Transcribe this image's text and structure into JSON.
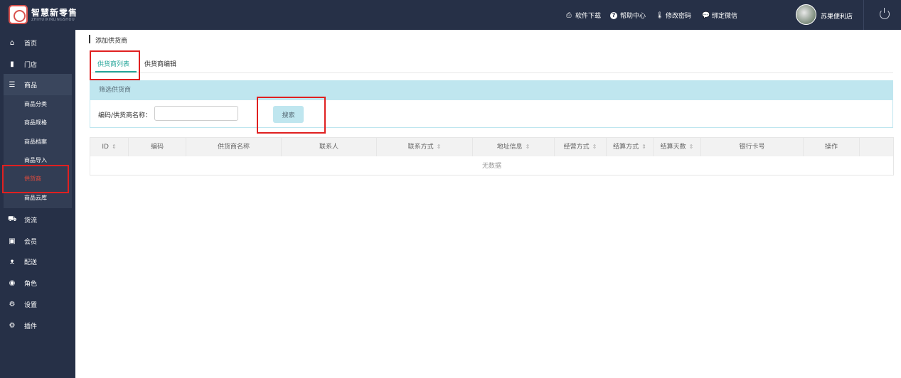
{
  "topbar": {
    "brand": "智慧新零售",
    "brand_sub": "ZHIHUIXINLINGSHOU",
    "links": {
      "download": "软件下载",
      "help": "帮助中心",
      "password": "修改密码",
      "wechat": "绑定微信"
    },
    "store_name": "苏果便利店"
  },
  "sidebar": {
    "items": {
      "home": "首页",
      "store": "门店",
      "goods": "商品",
      "logistics": "货流",
      "member": "会员",
      "delivery": "配送",
      "role": "角色",
      "settings": "设置",
      "plugins": "插件"
    },
    "sub_items": {
      "category": "商品分类",
      "spec": "商品规格",
      "archive": "商品档案",
      "import": "商品导入",
      "supplier": "供货商",
      "cloud": "商品云库"
    }
  },
  "main": {
    "breadcrumb": "添加供货商",
    "tabs": {
      "list": "供货商列表",
      "edit": "供货商编辑"
    },
    "filter": {
      "title": "筛选供货商",
      "label": "编码/供货商名称：",
      "value": "",
      "search": "搜索"
    },
    "table": {
      "columns": [
        "ID",
        "编码",
        "供货商名称",
        "联系人",
        "联系方式",
        "地址信息",
        "经营方式",
        "结算方式",
        "结算天数",
        "银行卡号",
        "操作"
      ],
      "sort_icon": "⇕",
      "empty": "无数据"
    }
  },
  "colors": {
    "topbar": "#263047",
    "accent": "#26a69a",
    "highlight": "#e02020",
    "filter_bg": "#bfe6ef"
  }
}
